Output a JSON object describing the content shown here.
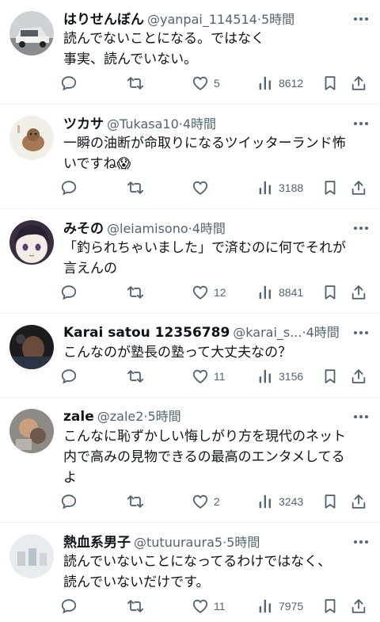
{
  "tweets": [
    {
      "name": "はりせんぼん",
      "handle": "@yanpai_114514",
      "dot": "·",
      "time": "5時間",
      "text": "読んでないことになる。ではなく\n事実、読んでいない。",
      "likes": "5",
      "views": "8612",
      "avatar": "car-avatar"
    },
    {
      "name": "ツカサ",
      "handle": "@Tukasa10",
      "dot": "·",
      "time": "4時間",
      "text": "一瞬の油断が命取りになるツイッターランド怖\nいですね😱",
      "likes": "",
      "views": "3188",
      "avatar": "animal-avatar"
    },
    {
      "name": "みその",
      "handle": "@leiamisono",
      "dot": "·",
      "time": "4時間",
      "text": "「釣られちゃいました」で済むのに何でそれが\n言えんの",
      "likes": "12",
      "views": "8841",
      "avatar": "anime-girl-avatar"
    },
    {
      "name": "Karai satou 12356789",
      "handle": "@karai_s...",
      "dot": "·",
      "time": "4時間",
      "text": "こんなのが塾長の塾って大丈夫なの？",
      "likes": "11",
      "views": "3156",
      "avatar": "dark-photo-avatar"
    },
    {
      "name": "zale",
      "handle": "@zale2",
      "dot": "·",
      "time": "5時間",
      "text": "こんなに恥ずかしい悔しがり方を現代のネット\n内で高みの見物できるの最高のエンタメしてる\nよ",
      "likes": "2",
      "views": "3243",
      "avatar": "figure-avatar"
    },
    {
      "name": "熱血系男子",
      "handle": "@tutuuraura5",
      "dot": "·",
      "time": "5時間",
      "text": "読んでいないことになってるわけではなく、\n読んでいないだけです。",
      "likes": "11",
      "views": "7975",
      "avatar": "figures-avatar"
    }
  ],
  "icons": {
    "reply": "reply-icon",
    "retweet": "retweet-icon",
    "like": "like-icon",
    "views": "views-icon",
    "bookmark": "bookmark-icon",
    "share": "share-icon",
    "more": "more-icon"
  },
  "colors": {
    "text": "#0f1419",
    "secondary": "#536471",
    "divider": "#eff3f4"
  }
}
